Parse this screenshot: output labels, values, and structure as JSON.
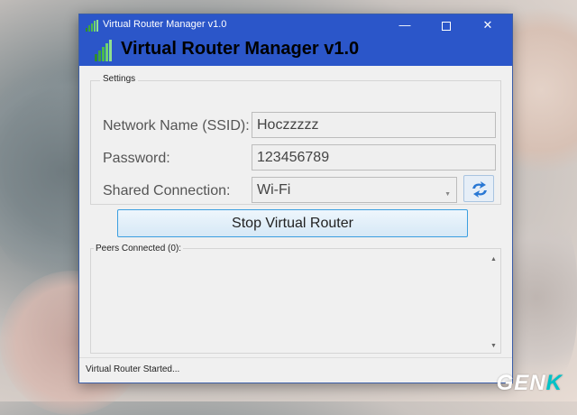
{
  "window": {
    "title": "Virtual Router Manager v1.0",
    "heading": "Virtual Router Manager v1.0",
    "buttons": {
      "minimize": "—",
      "close": "✕"
    }
  },
  "settings": {
    "group_label": "Settings",
    "ssid": {
      "label": "Network Name (SSID):",
      "value": "Hoczzzzz"
    },
    "password": {
      "label": "Password:",
      "value": "123456789"
    },
    "shared_connection": {
      "label": "Shared Connection:",
      "value": "Wi-Fi"
    },
    "refresh_icon": "refresh-icon"
  },
  "actions": {
    "stop_label": "Stop Virtual Router"
  },
  "peers": {
    "label": "Peers Connected (0):"
  },
  "status": {
    "text": "Virtual Router Started..."
  },
  "watermark": {
    "prefix": "GEN",
    "suffix": "K"
  },
  "colors": {
    "titlebar": "#2b56c9",
    "button_border": "#3c9fe0"
  }
}
